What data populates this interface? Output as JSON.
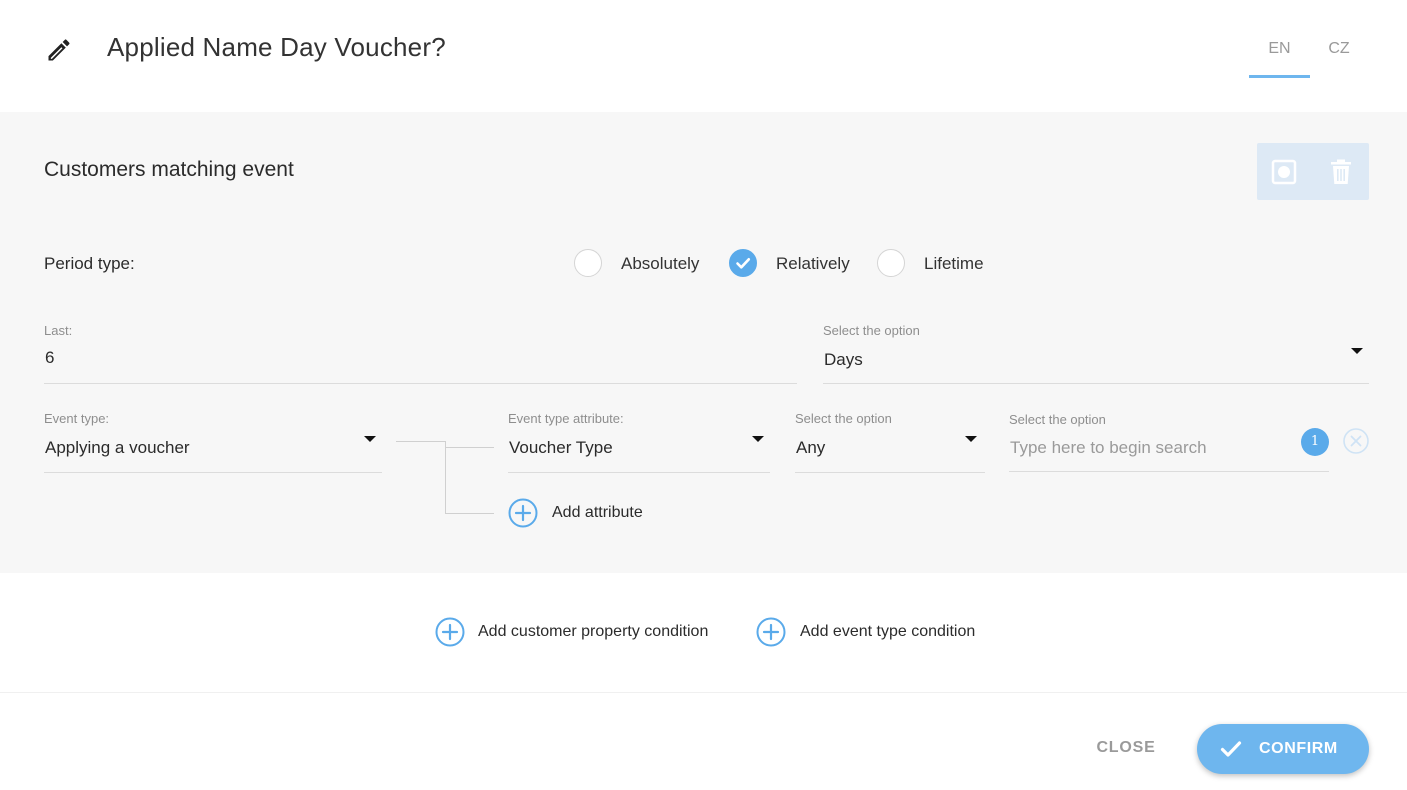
{
  "header": {
    "title": "Applied Name Day Voucher?",
    "languages": [
      "EN",
      "CZ"
    ],
    "active_language": "EN"
  },
  "condition": {
    "title": "Customers matching event",
    "period": {
      "label": "Period type:",
      "options": [
        "Absolutely",
        "Relatively",
        "Lifetime"
      ],
      "selected": "Relatively"
    },
    "last": {
      "label": "Last:",
      "value": "6"
    },
    "unit": {
      "label": "Select the option",
      "value": "Days"
    },
    "event_type": {
      "label": "Event type:",
      "value": "Applying a voucher"
    },
    "attribute": {
      "label": "Event type attribute:",
      "value": "Voucher Type"
    },
    "operator": {
      "label": "Select the option",
      "value": "Any"
    },
    "search": {
      "label": "Select the option",
      "placeholder": "Type here to begin search",
      "badge": "1"
    },
    "add_attribute_label": "Add attribute"
  },
  "actions": {
    "add_customer_property": "Add customer property condition",
    "add_event_type": "Add event type condition"
  },
  "footer": {
    "close": "CLOSE",
    "confirm": "CONFIRM"
  },
  "colors": {
    "accent": "#6eb6ee",
    "panel_bg": "#f7f7f7"
  }
}
